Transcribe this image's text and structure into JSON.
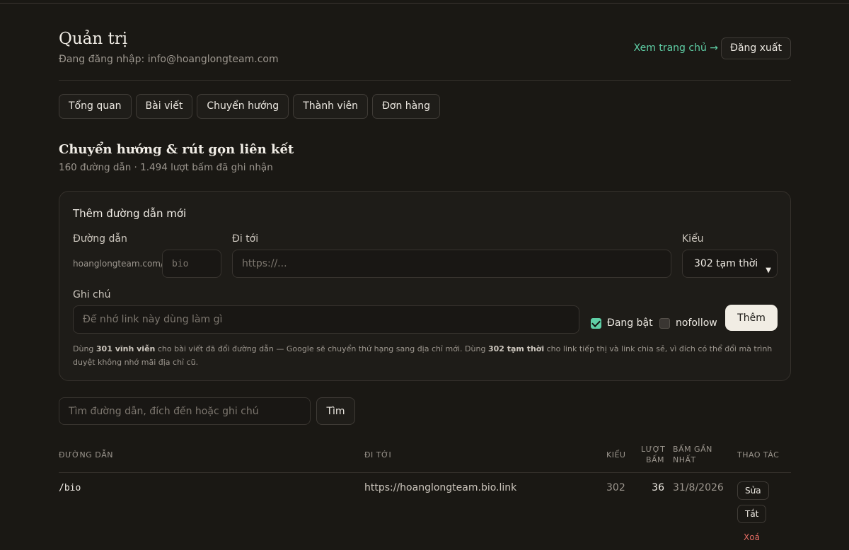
{
  "header": {
    "title": "Quản trị",
    "login_text": "Đang đăng nhập: info@hoanglongteam.com",
    "home_link": "Xem trang chủ →",
    "logout": "Đăng xuất"
  },
  "tabs": [
    {
      "label": "Tổng quan"
    },
    {
      "label": "Bài viết"
    },
    {
      "label": "Chuyển hướng"
    },
    {
      "label": "Thành viên"
    },
    {
      "label": "Đơn hàng"
    }
  ],
  "section": {
    "title": "Chuyển hướng & rút gọn liên kết",
    "subtitle": "160 đường dẫn · 1.494 lượt bấm đã ghi nhận"
  },
  "form": {
    "title": "Thêm đường dẫn mới",
    "path_label": "Đường dẫn",
    "prefix": "hoanglongteam.com/",
    "path_placeholder": "bio",
    "target_label": "Đi tới",
    "target_placeholder": "https://...",
    "type_label": "Kiểu",
    "type_value": "302 tạm thời",
    "note_label": "Ghi chú",
    "note_placeholder": "Để nhớ link này dùng làm gì",
    "enabled_label": "Đang bật",
    "enabled": true,
    "nofollow_label": "nofollow",
    "nofollow": false,
    "add_button": "Thêm",
    "help_1": "Dùng ",
    "help_b1": "301 vĩnh viễn",
    "help_2": " cho bài viết đã đổi đường dẫn — Google sẽ chuyển thứ hạng sang địa chỉ mới. Dùng ",
    "help_b2": "302 tạm thời",
    "help_3": " cho link tiếp thị và link chia sẻ, vì đích có thể đổi mà trình duyệt không nhớ mãi địa chỉ cũ."
  },
  "search": {
    "placeholder": "Tìm đường dẫn, đích đến hoặc ghi chú",
    "button": "Tìm"
  },
  "table": {
    "headers": {
      "path": "ĐƯỜNG DẪN",
      "target": "ĐI TỚI",
      "type": "KIỂU",
      "clicks_1": "LƯỢT",
      "clicks_2": "BẤM",
      "last_1": "BẤM GẦN",
      "last_2": "NHẤT",
      "actions": "THAO TÁC"
    },
    "rows": [
      {
        "path": "/bio",
        "target": "https://hoanglongteam.bio.link",
        "type": "302",
        "clicks": "36",
        "last": "31/8/2026",
        "edit": "Sửa",
        "toggle": "Tắt",
        "delete": "Xoá"
      }
    ]
  },
  "colors": {
    "background": "#1a1814",
    "accent": "#5fcfa6",
    "danger": "#e06a62",
    "primary_button": "#f1ede4"
  }
}
